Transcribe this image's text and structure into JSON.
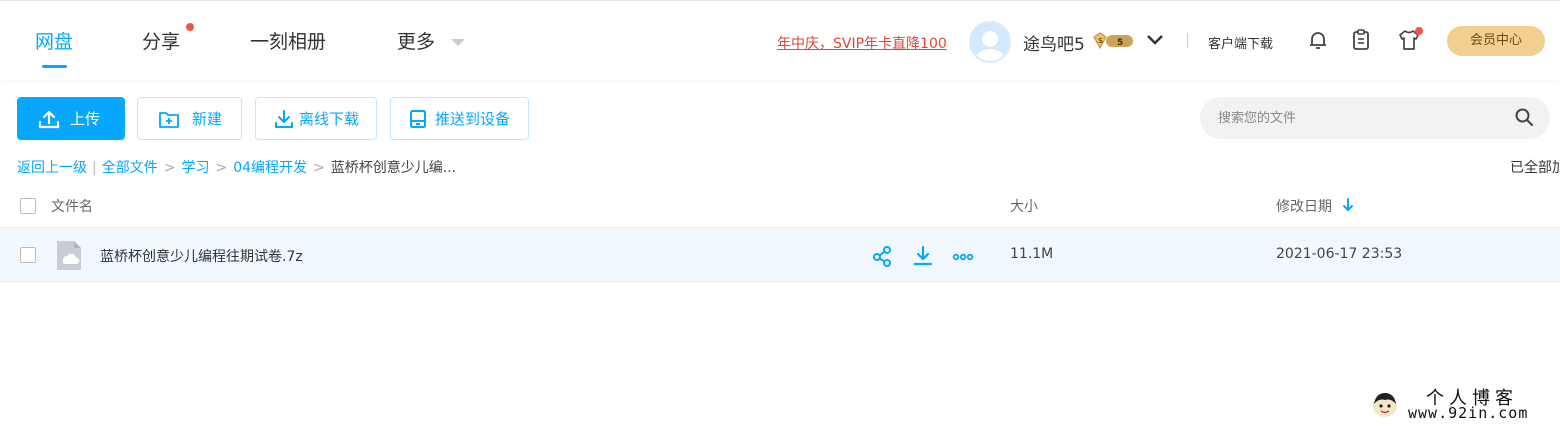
{
  "nav": {
    "items": [
      {
        "label": "网盘",
        "active": true
      },
      {
        "label": "分享",
        "has_dot": true
      },
      {
        "label": "一刻相册"
      },
      {
        "label": "更多"
      }
    ]
  },
  "header": {
    "promo_text": "年中庆，SVIP年卡直降100",
    "username": "途鸟吧5",
    "vip_level": "5",
    "client_download": "客户端下载",
    "member_center": "会员中心",
    "icons": [
      "bell-icon",
      "clipboard-icon",
      "tshirt-icon"
    ]
  },
  "toolbar": {
    "upload": "上传",
    "new": "新建",
    "offline_download": "离线下载",
    "push_to_device": "推送到设备"
  },
  "search": {
    "placeholder": "搜索您的文件"
  },
  "breadcrumb": {
    "back": "返回上一级",
    "items": [
      "全部文件",
      "学习",
      "04编程开发"
    ],
    "current": "蓝桥杯创意少儿编..."
  },
  "status": {
    "loaded_all": "已全部加载"
  },
  "table": {
    "headers": {
      "name": "文件名",
      "size": "大小",
      "modified": "修改日期"
    },
    "rows": [
      {
        "name": "蓝桥杯创意少儿编程往期试卷.7z",
        "size": "11.1M",
        "modified": "2021-06-17 23:53"
      }
    ]
  },
  "watermark": {
    "title": "个人博客",
    "url": "www.92in.com"
  },
  "colors": {
    "accent": "#06a7ff",
    "promo": "#e0453a",
    "member_bg": "#f2d08f",
    "row_highlight": "#f2f9fe",
    "dot": "#f0544b"
  }
}
